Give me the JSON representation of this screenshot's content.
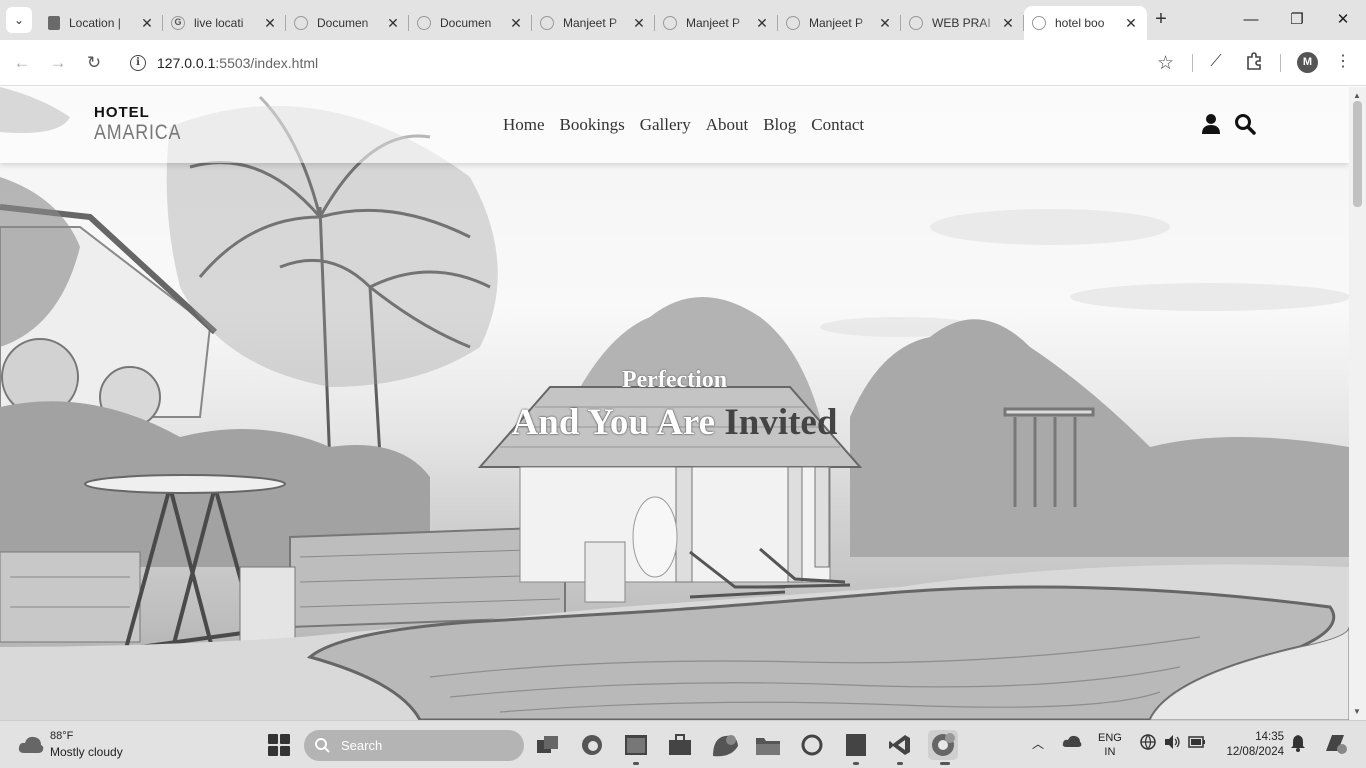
{
  "browser": {
    "tabs": [
      {
        "title": "Location |",
        "icon": "flag-icon"
      },
      {
        "title": "live locati",
        "icon": "google-icon"
      },
      {
        "title": "Documen",
        "icon": "globe-icon"
      },
      {
        "title": "Documen",
        "icon": "globe-icon"
      },
      {
        "title": "Manjeet P",
        "icon": "globe-icon"
      },
      {
        "title": "Manjeet P",
        "icon": "globe-icon"
      },
      {
        "title": "Manjeet P",
        "icon": "globe-icon"
      },
      {
        "title": "WEB PRAI",
        "icon": "globe-icon"
      },
      {
        "title": "hotel boo",
        "icon": "globe-icon"
      }
    ],
    "active_tab": 8,
    "new_tab": "+",
    "url_host": "127.0.0.1",
    "url_rest": ":5503/index.html",
    "profile_initial": "M"
  },
  "site": {
    "logo_top": "HOTEL",
    "logo_bottom": "AMARICA",
    "nav": [
      "Home",
      "Bookings",
      "Gallery",
      "About",
      "Blog",
      "Contact"
    ],
    "hero_sub": "Perfection",
    "hero_title_a": "And You Are ",
    "hero_title_b": "Invited"
  },
  "taskbar": {
    "weather_temp": "88°F",
    "weather_desc": "Mostly cloudy",
    "search_placeholder": "Search",
    "lang_1": "ENG",
    "lang_2": "IN",
    "time": "14:35",
    "date": "12/08/2024"
  }
}
